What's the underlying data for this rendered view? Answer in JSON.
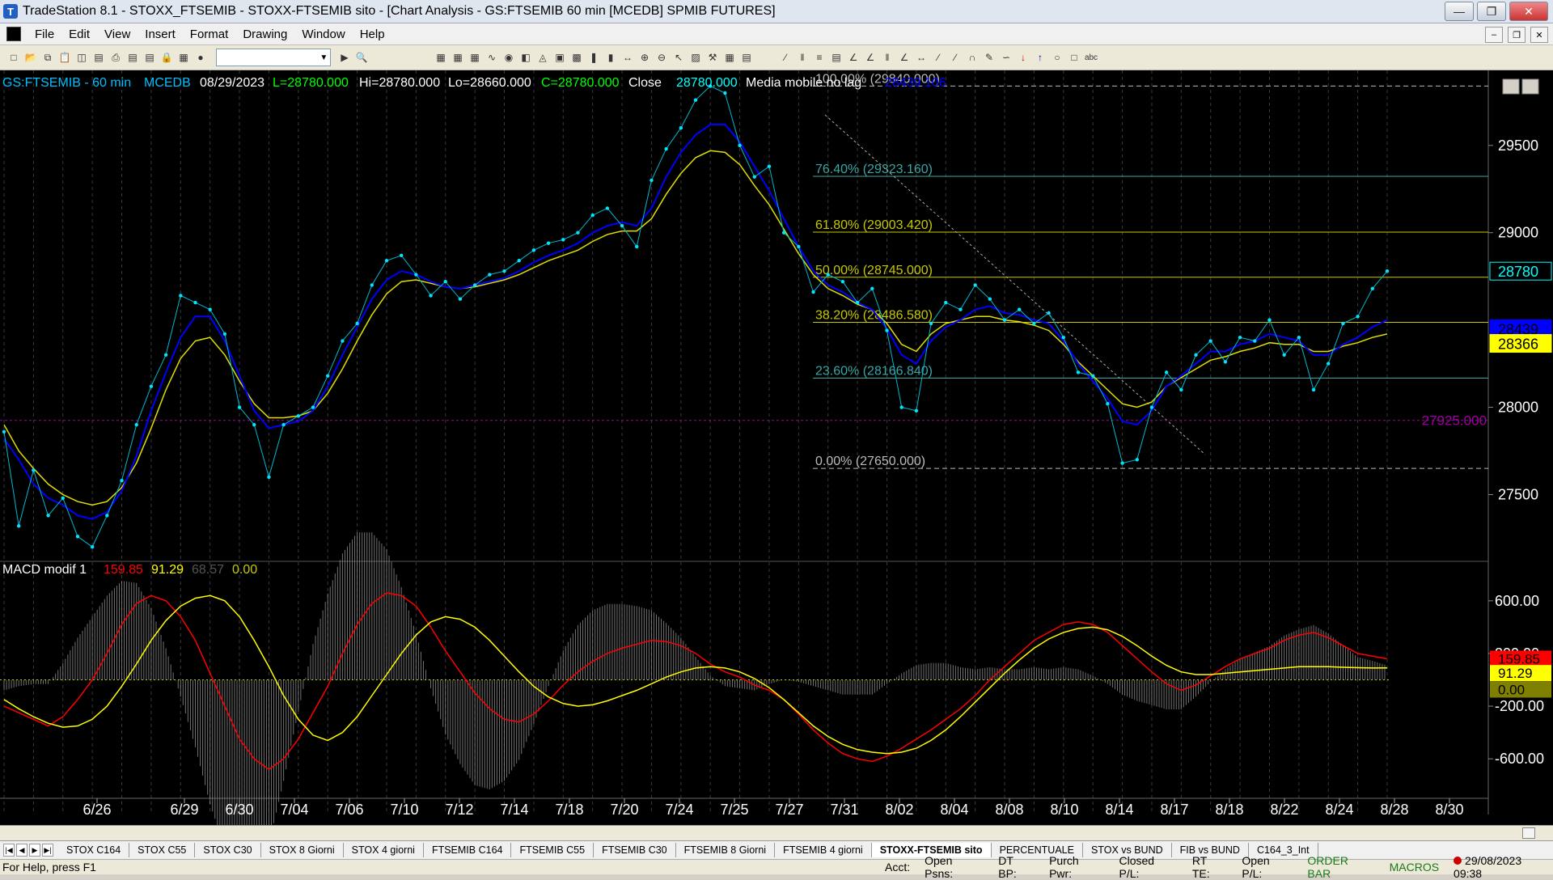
{
  "window": {
    "title": "TradeStation 8.1 - STOXX_FTSEMIB - STOXX-FTSEMIB sito - [Chart Analysis - GS:FTSEMIB  60 min  [MCEDB] SPMIB FUTURES]"
  },
  "menu": [
    "File",
    "Edit",
    "View",
    "Insert",
    "Format",
    "Drawing",
    "Window",
    "Help"
  ],
  "chart_header": {
    "symbol": "GS:FTSEMIB - 60 min",
    "code": "MCEDB",
    "date": "08/29/2023",
    "last": "L=28780.000",
    "high": "Hi=28780.000",
    "low": "Lo=28660.000",
    "close": "C=28780.000",
    "close_label": "Close",
    "close_value": "28780.000",
    "ma_label": "Media mobile no lag",
    "ma_value": "28439.106"
  },
  "macd_header": {
    "name": "MACD modif 1",
    "v1": "159.85",
    "v2": "91.29",
    "v3": "68.57",
    "v4": "0.00"
  },
  "fib_levels": [
    {
      "label": "100.00% (29840.000)",
      "price": 29840
    },
    {
      "label": "76.40% (29323.160)",
      "price": 29323.16
    },
    {
      "label": "61.80% (29003.420)",
      "price": 29003.42
    },
    {
      "label": "50.00% (28745.000)",
      "price": 28745
    },
    {
      "label": "38.20% (28486.580)",
      "price": 28486.58
    },
    {
      "label": "23.60% (28166.840)",
      "price": 28166.84
    },
    {
      "label": "0.00% (27650.000)",
      "price": 27650
    }
  ],
  "horizontal_line_label": "27925.000",
  "price_axis": {
    "ticks": [
      {
        "label": "29500",
        "price": 29500
      },
      {
        "label": "29000",
        "price": 29000
      },
      {
        "label": "28000",
        "price": 28000
      },
      {
        "label": "27500",
        "price": 27500
      }
    ],
    "badges": [
      {
        "label": "28780",
        "price": 28780,
        "bg": "#000000",
        "fg": "#00ffff"
      },
      {
        "label": "28439",
        "price": 28450,
        "bg": "#0000ff",
        "fg": "#000000"
      },
      {
        "label": "28366",
        "price": 28366,
        "bg": "#ffff00",
        "fg": "#000000"
      }
    ]
  },
  "macd_axis": {
    "ticks": [
      {
        "label": "600.00",
        "value": 600
      },
      {
        "label": "200.00",
        "value": 200
      },
      {
        "label": "-200.00",
        "value": -200
      },
      {
        "label": "-600.00",
        "value": -600
      }
    ],
    "badges": [
      {
        "label": "159.85",
        "value": 160,
        "bg": "#ff0000",
        "fg": "#000000"
      },
      {
        "label": "91.29",
        "value": 88,
        "bg": "#ffff00",
        "fg": "#000000"
      },
      {
        "label": "0.00",
        "value": 0,
        "bg": "#808000",
        "fg": "#000000"
      }
    ]
  },
  "date_axis": [
    "6/26",
    "6/29",
    "6/30",
    "7/04",
    "7/06",
    "7/10",
    "7/12",
    "7/14",
    "7/18",
    "7/20",
    "7/24",
    "7/25",
    "7/27",
    "7/31",
    "8/02",
    "8/04",
    "8/08",
    "8/10",
    "8/14",
    "8/17",
    "8/18",
    "8/22",
    "8/24",
    "8/28",
    "8/30"
  ],
  "tabs": [
    "STOX C164",
    "STOX C55",
    "STOX  C30",
    "STOX  8 Giorni",
    "STOX 4 giorni",
    "FTSEMIB C164",
    "FTSEMIB C55",
    "FTSEMIB C30",
    "FTSEMIB  8 Giorni",
    "FTSEMIB  4 giorni",
    "STOXX-FTSEMIB sito",
    "PERCENTUALE",
    "STOX vs BUND",
    "FIB vs BUND",
    "C164_3_Int"
  ],
  "active_tab": "STOXX-FTSEMIB sito",
  "status": {
    "help": "For Help, press F1",
    "acct": "Acct:",
    "open_psns": "Open Psns:",
    "dt_bp": "DT BP:",
    "purch_pwr": "Purch Pwr:",
    "closed_pl": "Closed P/L:",
    "rt_te": "RT TE:",
    "open_pl": "Open P/L:",
    "order_bar": "ORDER BAR",
    "macros": "MACROS",
    "datetime": "29/08/2023 09:38"
  },
  "colors": {
    "price": "#00e5ff",
    "ma_fast": "#0000ff",
    "ma_slow": "#e0e000",
    "fib_teal": "#3aa6a6",
    "fib_yellow": "#c8c800",
    "macd": "#ff0000",
    "signal": "#ffff00",
    "histogram": "#9a9a9a",
    "hline": "#a000a0"
  },
  "chart_data": {
    "type": "line",
    "y_range": [
      27150,
      29930
    ],
    "macd_range": [
      -900,
      900
    ],
    "x": [
      "6/23",
      "6/23",
      "6/26",
      "6/26",
      "6/27",
      "6/27",
      "6/28",
      "6/28",
      "6/29",
      "6/29",
      "6/30",
      "6/30",
      "7/03",
      "7/03",
      "7/04",
      "7/04",
      "7/05",
      "7/05",
      "7/06",
      "7/06",
      "7/07",
      "7/07",
      "7/10",
      "7/10",
      "7/11",
      "7/11",
      "7/12",
      "7/12",
      "7/13",
      "7/13",
      "7/14",
      "7/14",
      "7/17",
      "7/17",
      "7/18",
      "7/18",
      "7/19",
      "7/19",
      "7/20",
      "7/20",
      "7/21",
      "7/21",
      "7/24",
      "7/24",
      "7/25",
      "7/25",
      "7/26",
      "7/26",
      "7/27",
      "7/27",
      "7/28",
      "7/28",
      "7/31",
      "7/31",
      "8/01",
      "8/01",
      "8/02",
      "8/02",
      "8/03",
      "8/03",
      "8/04",
      "8/04",
      "8/07",
      "8/07",
      "8/08",
      "8/08",
      "8/09",
      "8/09",
      "8/10",
      "8/10",
      "8/11",
      "8/11",
      "8/14",
      "8/14",
      "8/15",
      "8/15",
      "8/16",
      "8/16",
      "8/17",
      "8/17",
      "8/18",
      "8/18",
      "8/21",
      "8/21",
      "8/22",
      "8/22",
      "8/23",
      "8/23",
      "8/24",
      "8/24",
      "8/25",
      "8/25",
      "8/28",
      "8/28",
      "8/29"
    ],
    "series": [
      {
        "name": "GS:FTSEMIB - 60 min",
        "values": [
          27860,
          27320,
          27640,
          27380,
          27480,
          27260,
          27200,
          27380,
          27580,
          27900,
          28120,
          28300,
          28640,
          28600,
          28560,
          28420,
          28000,
          27900,
          27600,
          27900,
          27950,
          28000,
          28180,
          28380,
          28480,
          28700,
          28840,
          28870,
          28760,
          28640,
          28720,
          28620,
          28700,
          28760,
          28780,
          28840,
          28900,
          28940,
          28960,
          29000,
          29100,
          29140,
          29040,
          28920,
          29300,
          29480,
          29600,
          29760,
          29840,
          29800,
          29500,
          29320,
          29380,
          29000,
          28920,
          28660,
          28760,
          28720,
          28600,
          28680,
          28440,
          28000,
          27980,
          28480,
          28600,
          28560,
          28700,
          28620,
          28500,
          28560,
          28480,
          28540,
          28400,
          28200,
          28180,
          28020,
          27680,
          27700,
          28000,
          28200,
          28100,
          28300,
          28380,
          28260,
          28400,
          28380,
          28500,
          28300,
          28400,
          28100,
          28250,
          28480,
          28520,
          28680,
          28780
        ]
      },
      {
        "name": "Media mobile no lag",
        "values": [
          27820,
          27700,
          27560,
          27480,
          27440,
          27380,
          27360,
          27400,
          27520,
          27720,
          27980,
          28200,
          28400,
          28520,
          28520,
          28380,
          28180,
          27980,
          27880,
          27900,
          27920,
          27980,
          28120,
          28300,
          28460,
          28620,
          28730,
          28780,
          28760,
          28720,
          28690,
          28680,
          28700,
          28720,
          28740,
          28780,
          28830,
          28870,
          28900,
          28940,
          29000,
          29040,
          29060,
          29040,
          29140,
          29320,
          29460,
          29560,
          29620,
          29620,
          29520,
          29380,
          29240,
          29080,
          28920,
          28780,
          28700,
          28660,
          28600,
          28560,
          28450,
          28300,
          28250,
          28380,
          28460,
          28500,
          28560,
          28580,
          28540,
          28530,
          28500,
          28480,
          28380,
          28250,
          28150,
          28050,
          27920,
          27900,
          27980,
          28120,
          28180,
          28250,
          28320,
          28320,
          28360,
          28380,
          28420,
          28400,
          28380,
          28300,
          28300,
          28360,
          28400,
          28460,
          28500
        ]
      },
      {
        "name": "",
        "values": [
          27900,
          27750,
          27650,
          27560,
          27500,
          27460,
          27440,
          27460,
          27540,
          27680,
          27880,
          28100,
          28280,
          28380,
          28400,
          28300,
          28150,
          28020,
          27940,
          27940,
          27950,
          27980,
          28080,
          28220,
          28380,
          28530,
          28650,
          28720,
          28730,
          28710,
          28690,
          28680,
          28690,
          28710,
          28730,
          28760,
          28800,
          28840,
          28870,
          28900,
          28950,
          28990,
          29010,
          29010,
          29080,
          29220,
          29340,
          29430,
          29470,
          29460,
          29390,
          29270,
          29160,
          29020,
          28880,
          28760,
          28680,
          28640,
          28590,
          28560,
          28480,
          28360,
          28320,
          28420,
          28480,
          28500,
          28520,
          28520,
          28500,
          28490,
          28470,
          28440,
          28360,
          28260,
          28180,
          28100,
          28020,
          28000,
          28030,
          28120,
          28170,
          28220,
          28270,
          28290,
          28320,
          28340,
          28370,
          28360,
          28360,
          28320,
          28320,
          28350,
          28370,
          28400,
          28420
        ]
      },
      {
        "name": "MACD modif 1",
        "values": [
          -200,
          -250,
          -300,
          -350,
          -280,
          -150,
          0,
          200,
          420,
          580,
          640,
          600,
          480,
          300,
          50,
          -200,
          -450,
          -600,
          -680,
          -600,
          -450,
          -250,
          -50,
          200,
          420,
          580,
          660,
          640,
          560,
          400,
          220,
          60,
          -100,
          -220,
          -300,
          -320,
          -260,
          -160,
          -40,
          60,
          140,
          200,
          240,
          270,
          300,
          290,
          260,
          200,
          120,
          60,
          20,
          -40,
          -80,
          -150,
          -260,
          -380,
          -480,
          -560,
          -600,
          -620,
          -580,
          -520,
          -450,
          -380,
          -300,
          -220,
          -120,
          0,
          100,
          200,
          300,
          360,
          420,
          440,
          420,
          360,
          260,
          160,
          60,
          -30,
          -80,
          -40,
          30,
          100,
          160,
          200,
          240,
          300,
          340,
          360,
          320,
          260,
          200,
          180,
          160
        ]
      },
      {
        "name": "",
        "values": [
          -150,
          -220,
          -280,
          -330,
          -360,
          -350,
          -300,
          -200,
          -50,
          120,
          300,
          450,
          560,
          620,
          640,
          600,
          480,
          300,
          100,
          -120,
          -300,
          -420,
          -460,
          -400,
          -280,
          -120,
          40,
          200,
          340,
          440,
          480,
          460,
          400,
          300,
          180,
          60,
          -50,
          -130,
          -180,
          -200,
          -190,
          -160,
          -120,
          -80,
          -30,
          20,
          60,
          90,
          100,
          90,
          60,
          10,
          -60,
          -150,
          -250,
          -350,
          -430,
          -490,
          -530,
          -550,
          -560,
          -550,
          -520,
          -460,
          -380,
          -280,
          -170,
          -60,
          50,
          150,
          240,
          310,
          360,
          390,
          400,
          380,
          330,
          260,
          180,
          110,
          60,
          40,
          40,
          50,
          60,
          70,
          80,
          90,
          100,
          100,
          100,
          95,
          92,
          90,
          91
        ]
      }
    ]
  }
}
